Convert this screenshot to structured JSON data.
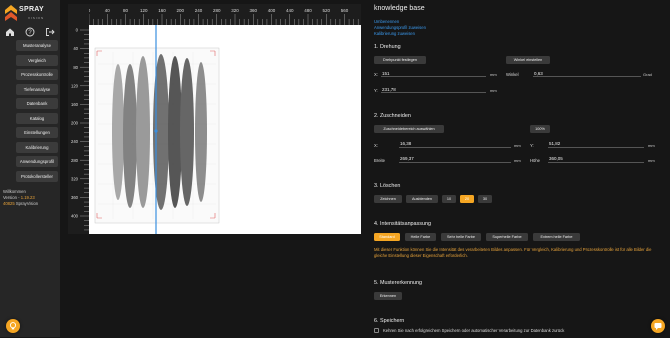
{
  "brand": {
    "name_line1": "SPRAY",
    "name_line2": "VISION",
    "sub": "VISION"
  },
  "sidebar": {
    "items": [
      {
        "label": "Musteranalyse"
      },
      {
        "label": "Vergleich"
      },
      {
        "label": "Prozesskontrolle"
      },
      {
        "label": "Tiefenanalyse"
      },
      {
        "label": "Datenbank"
      },
      {
        "label": "Katalog"
      },
      {
        "label": "Einstellungen"
      },
      {
        "label": "Kalibrierung"
      },
      {
        "label": "Anwendungsprofil"
      },
      {
        "label": "Protokollersteller"
      }
    ],
    "welcome": "Willkommen",
    "version_label": "Version -",
    "version": "1.19.23",
    "device_id": "40825",
    "device_name": "SprayVision"
  },
  "ruler": {
    "h_ticks": [
      "0",
      "40",
      "80",
      "120",
      "160",
      "200",
      "240",
      "280",
      "320",
      "360",
      "400",
      "440",
      "480",
      "520",
      "560",
      "600"
    ],
    "v_ticks": [
      "0",
      "40",
      "80",
      "120",
      "160",
      "200",
      "240",
      "280",
      "320",
      "360",
      "400",
      "440"
    ]
  },
  "panel": {
    "title": "knowledge base",
    "links": [
      "Umbenennen",
      "Anwendungsprofil zuweisen",
      "Kalibrierung zuweisen"
    ],
    "section1": {
      "title": "1. Drehung",
      "btn_pivot": "Drehpunkt festlegen",
      "btn_angle": "Winkel einstellen",
      "x_label": "X:",
      "x_value": "151",
      "x_unit": "mm",
      "y_label": "Y:",
      "y_value": "231,78",
      "y_unit": "mm",
      "angle_label": "Winkel",
      "angle_value": "0,63",
      "angle_unit": "Grad"
    },
    "section2": {
      "title": "2. Zuschneiden",
      "btn_select": "Zuschneidebereich auswählen",
      "zoom": "100%",
      "x_label": "X:",
      "x_value": "16,38",
      "x_unit": "mm",
      "y_label": "Y:",
      "y_value": "51,82",
      "y_unit": "mm",
      "w_label": "Breite",
      "w_value": "269,37",
      "w_unit": "mm",
      "h_label": "Höhe",
      "h_value": "360,05",
      "h_unit": "mm"
    },
    "section3": {
      "title": "3. Löschen",
      "btn_draw": "Zeichnen",
      "btn_hide": "Ausblenden",
      "sizes": [
        "10",
        "20",
        "30"
      ],
      "active_size": "20"
    },
    "section4": {
      "title": "4. Intensitätsanpassung",
      "options": [
        "Standard",
        "Helle Farbe",
        "Sehr helle Farbe",
        "Superhelle Farbe",
        "Extrem helle Farbe"
      ],
      "active": "Standard",
      "info": "Mit dieser Funktion können Sie die Intensität des verarbeiteten Bildes anpassen. Für Vergleich, Kalibrierung und Prozesskontrolle ist für alle Bilder die gleiche Einstellung dieser Eigenschaft erforderlich."
    },
    "section5": {
      "title": "5. Mustererkennung",
      "btn": "Erkennen"
    },
    "section6": {
      "title": "6. Speichern",
      "checkbox_label": "Kehren Sie nach erfolgreichem Speichern oder automatischer Verarbeitung zur Datenbank zurück"
    }
  },
  "colors": {
    "accent": "#f5a623",
    "link": "#3b9bf0",
    "guide": "#3a8fe0"
  }
}
